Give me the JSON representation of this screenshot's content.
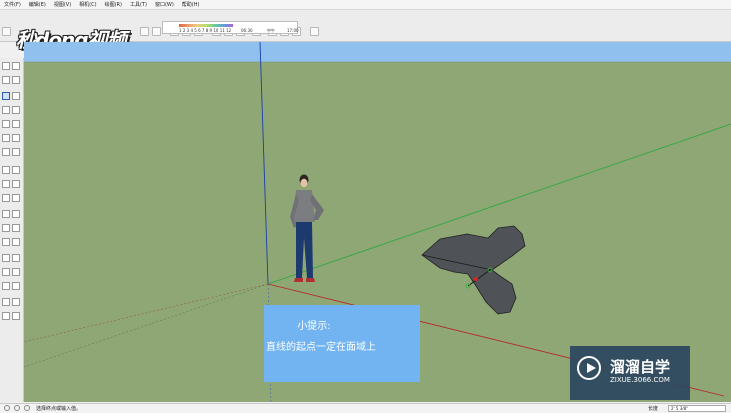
{
  "menu": [
    "文件(F)",
    "编辑(E)",
    "视图(V)",
    "相机(C)",
    "绘图(R)",
    "工具(T)",
    "窗口(W)",
    "帮助(H)"
  ],
  "watermark": "秒dong视频",
  "scale": {
    "numbers": "1 2 3 4 5 6 7 8 9 10 11 12",
    "a": "06:30",
    "b": "中午",
    "c": "17:00"
  },
  "tip": {
    "title": "小提示:",
    "body": "直线的起点一定在面域上"
  },
  "logo": {
    "title": "溜溜自学",
    "url": "ZIXUE.3066.COM"
  },
  "status": {
    "hint": "选择终点或输入值。",
    "length_label": "长度",
    "length_value": "2' 5 3/8\""
  },
  "colors": {
    "sky": "#8fc0ee",
    "ground": "#8ea775",
    "tip_box": "#71b4f1",
    "shape": "#4f5357"
  }
}
